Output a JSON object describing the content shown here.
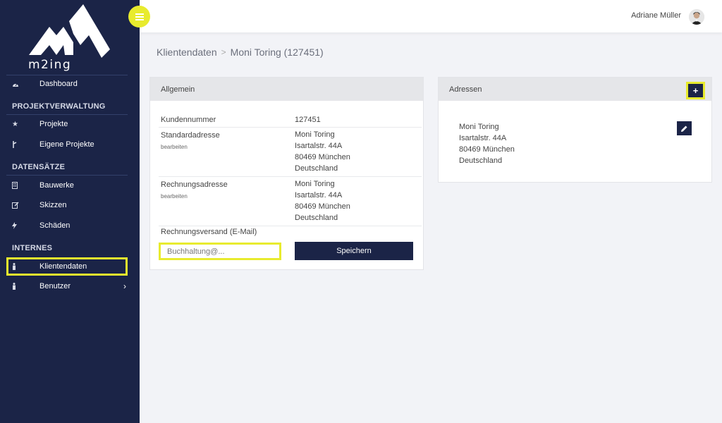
{
  "brand": {
    "name": "m2ing"
  },
  "user": {
    "name": "Adriane Müller"
  },
  "sidebar": {
    "dashboard": {
      "label": "Dashboard",
      "icon": "dashboard-icon"
    },
    "sections": [
      {
        "title": "PROJEKTVERWALTUNG"
      },
      {
        "title": "DATENSÄTZE"
      },
      {
        "title": "INTERNES"
      }
    ],
    "items": [
      {
        "label": "Projekte",
        "icon": "star-icon"
      },
      {
        "label": "Eigene Projekte",
        "icon": "fork-icon"
      },
      {
        "label": "Bauwerke",
        "icon": "building-icon"
      },
      {
        "label": "Skizzen",
        "icon": "edit-icon"
      },
      {
        "label": "Schäden",
        "icon": "bolt-icon"
      },
      {
        "label": "Klientendaten",
        "icon": "person-icon",
        "active": true
      },
      {
        "label": "Benutzer",
        "icon": "person-icon",
        "chevron": "›"
      }
    ]
  },
  "breadcrumb": {
    "parent": "Klientendaten",
    "separator": ">",
    "current": "Moni Toring (127451)"
  },
  "allgemein": {
    "title": "Allgemein",
    "kundennummer": {
      "label": "Kundennummer",
      "value": "127451"
    },
    "standardadresse": {
      "label": "Standardadresse",
      "sub": "bearbeiten",
      "lines": [
        "Moni Toring",
        "Isartalstr. 44A",
        "80469 München",
        "Deutschland"
      ]
    },
    "rechnungsadresse": {
      "label": "Rechnungsadresse",
      "sub": "bearbeiten",
      "lines": [
        "Moni Toring",
        "Isartalstr. 44A",
        "80469 München",
        "Deutschland"
      ]
    },
    "versand": {
      "label": "Rechnungsversand (E-Mail)",
      "value": "Buchhaltung@..."
    },
    "save_label": "Speichern"
  },
  "adressen": {
    "title": "Adressen",
    "add_label": "+",
    "address_lines": [
      "Moni Toring",
      "Isartalstr. 44A",
      "80469 München",
      "Deutschland"
    ]
  },
  "colors": {
    "sidebar": "#1b2447",
    "highlight": "#e8eb2e",
    "background": "#f2f3f7"
  }
}
